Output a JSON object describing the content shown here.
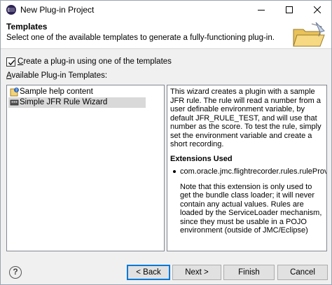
{
  "window": {
    "title": "New Plug-in Project",
    "minimize_icon": "minimize-icon",
    "maximize_icon": "maximize-icon",
    "close_icon": "close-icon"
  },
  "banner": {
    "title": "Templates",
    "description": "Select one of the available templates to generate a fully-functioning plug-in.",
    "image_icon": "folder-wizard-icon"
  },
  "create_checkbox": {
    "checked": true,
    "label_mnemonic": "C",
    "label_rest": "reate a plug-in using one of the templates"
  },
  "templates": {
    "label_mnemonic": "A",
    "label_rest": "vailable Plug-in Templates:",
    "items": [
      {
        "label": "Sample help content",
        "icon": "help-content-icon",
        "selected": false
      },
      {
        "label": "Simple JFR Rule Wizard",
        "icon": "jfr-rule-icon",
        "selected": true
      }
    ]
  },
  "description": {
    "intro": "This wizard creates a plugin with a sample JFR rule. The rule will read a number from a user definable environment variable, by default JFR_RULE_TEST, and will use that number as the score. To test the rule, simply set the environment variable and create a short recording.",
    "extensions_heading": "Extensions Used",
    "extension": "com.oracle.jmc.flightrecorder.rules.ruleProvider",
    "note": "Note that this extension is only used to get the bundle class loader; it will never contain any actual values. Rules are loaded by the ServiceLoader mechanism, since they must be usable in a POJO environment (outside of JMC/Eclipse)"
  },
  "buttons": {
    "help": "?",
    "back": "< Back",
    "next": "Next >",
    "finish": "Finish",
    "cancel": "Cancel"
  }
}
